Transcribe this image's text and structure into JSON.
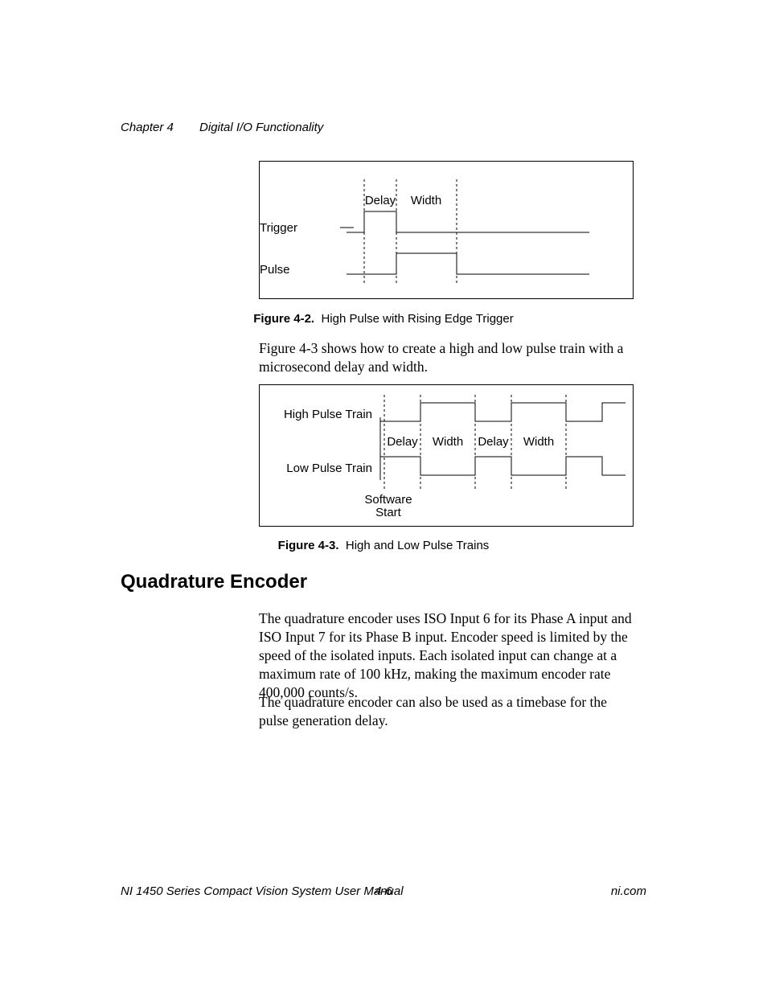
{
  "header": {
    "chapter": "Chapter 4",
    "title": "Digital I/O Functionality"
  },
  "fig1": {
    "labels": {
      "trigger": "Trigger",
      "pulse": "Pulse",
      "delay": "Delay",
      "width": "Width"
    },
    "caption_b": "Figure 4-2.",
    "caption_t": "High Pulse with Rising Edge Trigger"
  },
  "para1": "Figure 4-3 shows how to create a high and low pulse train with a microsecond delay and width.",
  "fig2": {
    "labels": {
      "high": "High Pulse Train",
      "low": "Low Pulse Train",
      "delay": "Delay",
      "width": "Width",
      "soft1": "Software",
      "soft2": "Start"
    },
    "caption_b": "Figure 4-3.",
    "caption_t": "High and Low Pulse Trains"
  },
  "heading": "Quadrature Encoder",
  "para2": "The quadrature encoder uses ISO Input 6 for its Phase A input and ISO Input 7 for its Phase B input. Encoder speed is limited by the speed of the isolated inputs. Each isolated input can change at a maximum rate of 100 kHz, making the maximum encoder rate 400,000 counts/s.",
  "para3": "The quadrature encoder can also be used as a timebase for the pulse generation delay.",
  "footer": {
    "manual": "NI 1450 Series Compact Vision System User Manual",
    "page": "4-6",
    "site": "ni.com"
  },
  "chart_data": [
    {
      "type": "timing-diagram",
      "title": "High Pulse with Rising Edge Trigger",
      "signals": [
        {
          "name": "Trigger",
          "segments": [
            {
              "level": "low",
              "from": 0,
              "to": 1
            },
            {
              "level": "high",
              "from": 1,
              "to": 2
            },
            {
              "level": "low",
              "from": 2,
              "to": 7
            }
          ]
        },
        {
          "name": "Pulse",
          "segments": [
            {
              "level": "low",
              "from": 0,
              "to": 2
            },
            {
              "level": "high",
              "from": 2,
              "to": 3.2
            },
            {
              "level": "low",
              "from": 3.2,
              "to": 7
            }
          ]
        }
      ],
      "annotations": [
        {
          "text": "Delay",
          "between": [
            "Trigger rising edge",
            "Pulse rising edge"
          ]
        },
        {
          "text": "Width",
          "between": [
            "Pulse rising edge",
            "Pulse falling edge"
          ]
        }
      ]
    },
    {
      "type": "timing-diagram",
      "title": "High and Low Pulse Trains",
      "signals": [
        {
          "name": "High Pulse Train",
          "pattern": "low-high-low-high-low-high",
          "boundaries": [
            0,
            1,
            2,
            3,
            4,
            5,
            6
          ]
        },
        {
          "name": "Low Pulse Train",
          "pattern": "high-low-high-low-high-low",
          "boundaries": [
            0,
            1,
            2,
            3,
            4,
            5,
            6
          ]
        }
      ],
      "annotations": [
        {
          "text": "Software Start",
          "at": 0
        },
        {
          "text": "Delay",
          "between": [
            0,
            1
          ]
        },
        {
          "text": "Width",
          "between": [
            1,
            2
          ]
        },
        {
          "text": "Delay",
          "between": [
            2,
            3
          ]
        },
        {
          "text": "Width",
          "between": [
            3,
            4
          ]
        }
      ]
    }
  ]
}
